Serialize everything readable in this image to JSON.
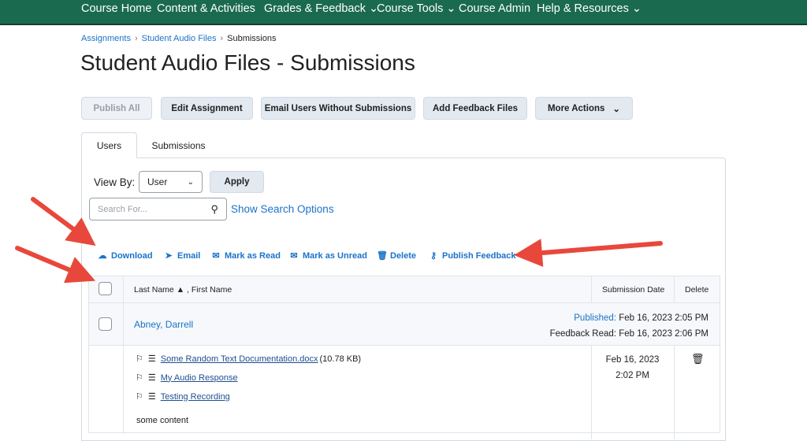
{
  "nav": {
    "items": [
      "Course Home",
      "Content & Activities",
      "Grades & Feedback ⌄",
      "Course Tools ⌄",
      "Course Admin",
      "Help & Resources ⌄"
    ]
  },
  "breadcrumb": [
    "Assignments",
    "Student Audio Files",
    "Submissions"
  ],
  "title": "Student Audio Files - Submissions",
  "toolbar": {
    "publish_all": "Publish All",
    "edit_assignment": "Edit Assignment",
    "email_users": "Email Users Without Submissions",
    "add_feedback": "Add Feedback Files",
    "more_actions": "More Actions"
  },
  "tabs": [
    "Users",
    "Submissions"
  ],
  "view_by": {
    "label": "View By:",
    "value": "User",
    "apply": "Apply"
  },
  "search": {
    "placeholder": "Search For...",
    "options": "Show Search Options"
  },
  "actions": [
    "Download",
    "Email",
    "Mark as Read",
    "Mark as Unread",
    "Delete",
    "Publish Feedback"
  ],
  "table": {
    "headers": {
      "name": "Last Name ▲ , First Name",
      "date": "Submission Date",
      "delete": "Delete"
    },
    "user": {
      "name": "Abney, Darrell",
      "published_label": "Published:",
      "published": "Feb 16, 2023 2:05 PM",
      "read_label": "Feedback Read:",
      "read": "Feb 16, 2023 2:06 PM"
    },
    "files": [
      {
        "name": "Some Random Text Documentation.docx",
        "size": "(10.78 KB)"
      },
      {
        "name": "My Audio Response",
        "size": ""
      },
      {
        "name": "Testing Recording",
        "size": ""
      }
    ],
    "comment": "some content",
    "submission_date": "Feb 16, 2023",
    "submission_time": "2:02 PM"
  },
  "colors": {
    "nav": "#1a6a4f",
    "link": "#1a73c8",
    "arrow": "#e8483b"
  }
}
